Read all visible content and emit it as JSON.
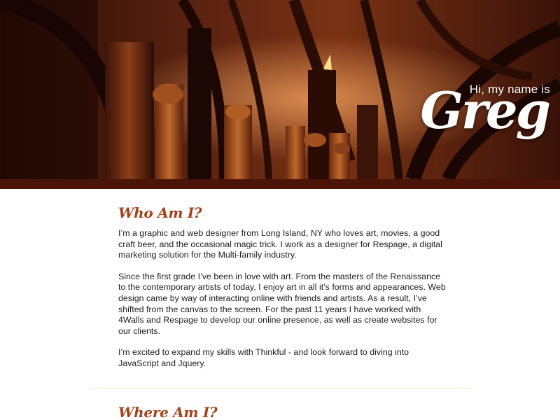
{
  "hero": {
    "greeting": "Hi, my name is",
    "name": "Greg",
    "image_description_icon": "vaulted-arches-image",
    "colors": {
      "deep": "#2a0d05",
      "mid": "#6b2a10",
      "warm": "#b3521f",
      "light": "#e8a060",
      "band": "#4a1508"
    }
  },
  "about": {
    "title": "Who Am I?",
    "paragraphs": [
      "I’m a graphic and web designer from Long Island, NY who loves art, movies, a good craft beer, and the occasional magic trick. I work as a designer for Respage, a digital marketing solution for the Multi-family industry.",
      "Since the first grade I’ve been in love with art. From the masters of the Renaissance to the contemporary artists of today, I enjoy art in all it’s forms and appearances. Web design came by way of interacting online with friends and artists. As a result, I’ve shifted from the canvas to the screen. For the past 11 years I have worked with 4Walls and Respage to develop our online presence, as well as create websites for our clients.",
      "I’m excited to expand my skills with Thinkful - and look forward to diving into JavaScript and Jquery."
    ]
  },
  "where": {
    "title": "Where Am I?"
  },
  "colors": {
    "heading": "#a5421c",
    "body_text": "#1e1e1e",
    "divider": "#f3e4cf"
  }
}
